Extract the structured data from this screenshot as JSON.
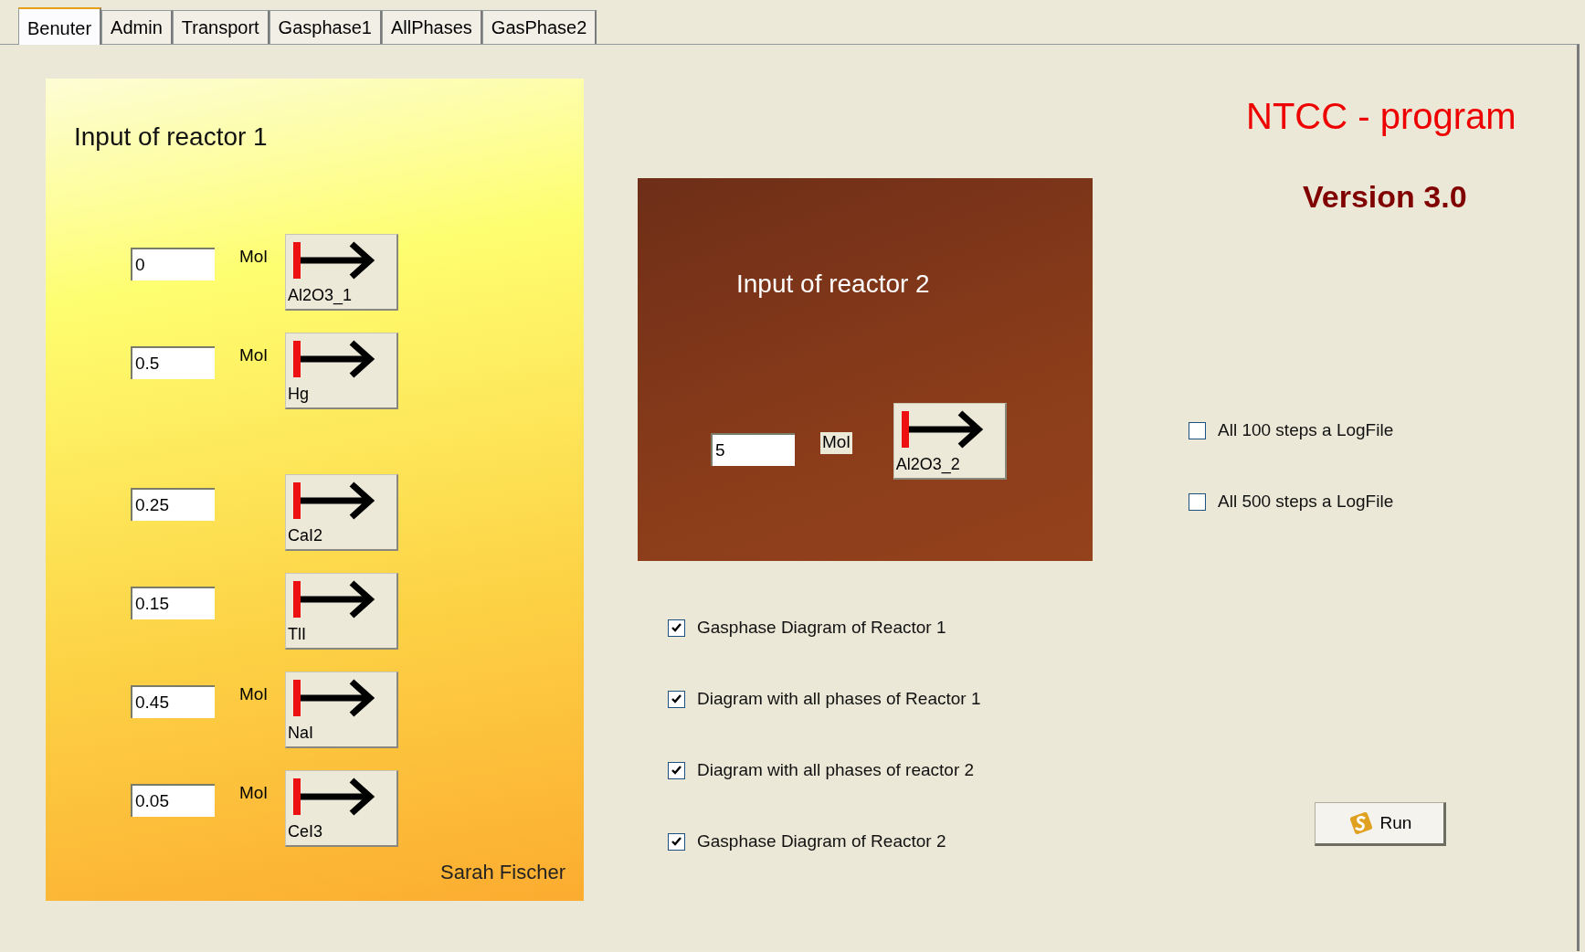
{
  "tabs": [
    {
      "label": "Benuter",
      "selected": true
    },
    {
      "label": "Admin",
      "selected": false
    },
    {
      "label": "Transport",
      "selected": false
    },
    {
      "label": "Gasphase1",
      "selected": false
    },
    {
      "label": "AllPhases",
      "selected": false
    },
    {
      "label": "GasPhase2",
      "selected": false
    }
  ],
  "reactor1": {
    "title": "Input of reactor 1",
    "groups": [
      [
        {
          "value": "0",
          "unit": "Mol",
          "button": "Al2O3_1"
        },
        {
          "value": "0.5",
          "unit": "Mol",
          "button": "Hg"
        }
      ],
      [
        {
          "value": "0.25",
          "button": "CaI2"
        },
        {
          "value": "0.15",
          "button": "TlI"
        },
        {
          "value": "0.45",
          "unit": "Mol",
          "button": "NaI"
        },
        {
          "value": "0.05",
          "unit": "Mol",
          "button": "CeI3"
        }
      ]
    ],
    "author": "Sarah Fischer"
  },
  "reactor2": {
    "title": "Input of reactor 2",
    "value": "5",
    "unit": "Mol",
    "button": "Al2O3_2"
  },
  "diagram_options": [
    {
      "label": "Gasphase Diagram of Reactor 1",
      "checked": true
    },
    {
      "label": "Diagram with all phases of Reactor 1",
      "checked": true
    },
    {
      "label": "Diagram with all phases of reactor 2",
      "checked": true
    },
    {
      "label": "Gasphase Diagram of Reactor 2",
      "checked": true
    }
  ],
  "app_title": "NTCC - program",
  "version": "Version 3.0",
  "log_options": [
    {
      "label": "All 100 steps a LogFile",
      "checked": false
    },
    {
      "label": "All 500 steps a LogFile",
      "checked": false
    }
  ],
  "run_button": "Run"
}
